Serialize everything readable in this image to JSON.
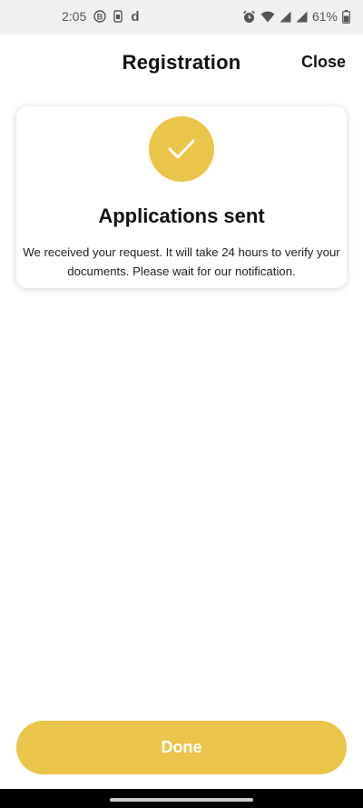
{
  "status_bar": {
    "time": "2:05",
    "battery_percent": "61%",
    "icons_left": [
      "b-circle-icon",
      "sim-icon",
      "d-app-icon"
    ],
    "icons_right": [
      "alarm-icon",
      "wifi-icon",
      "signal-icon",
      "signal-icon",
      "battery-icon"
    ]
  },
  "header": {
    "title": "Registration",
    "close_label": "Close"
  },
  "card": {
    "icon": "checkmark-icon",
    "title": "Applications sent",
    "message": "We received your request. It will take 24 hours to verify your documents. Please wait for our notification."
  },
  "actions": {
    "done_label": "Done"
  },
  "colors": {
    "accent": "#ebc44a",
    "text": "#111111",
    "status_bar_bg": "#f0f0f0",
    "nav_bar_bg": "#000000"
  }
}
